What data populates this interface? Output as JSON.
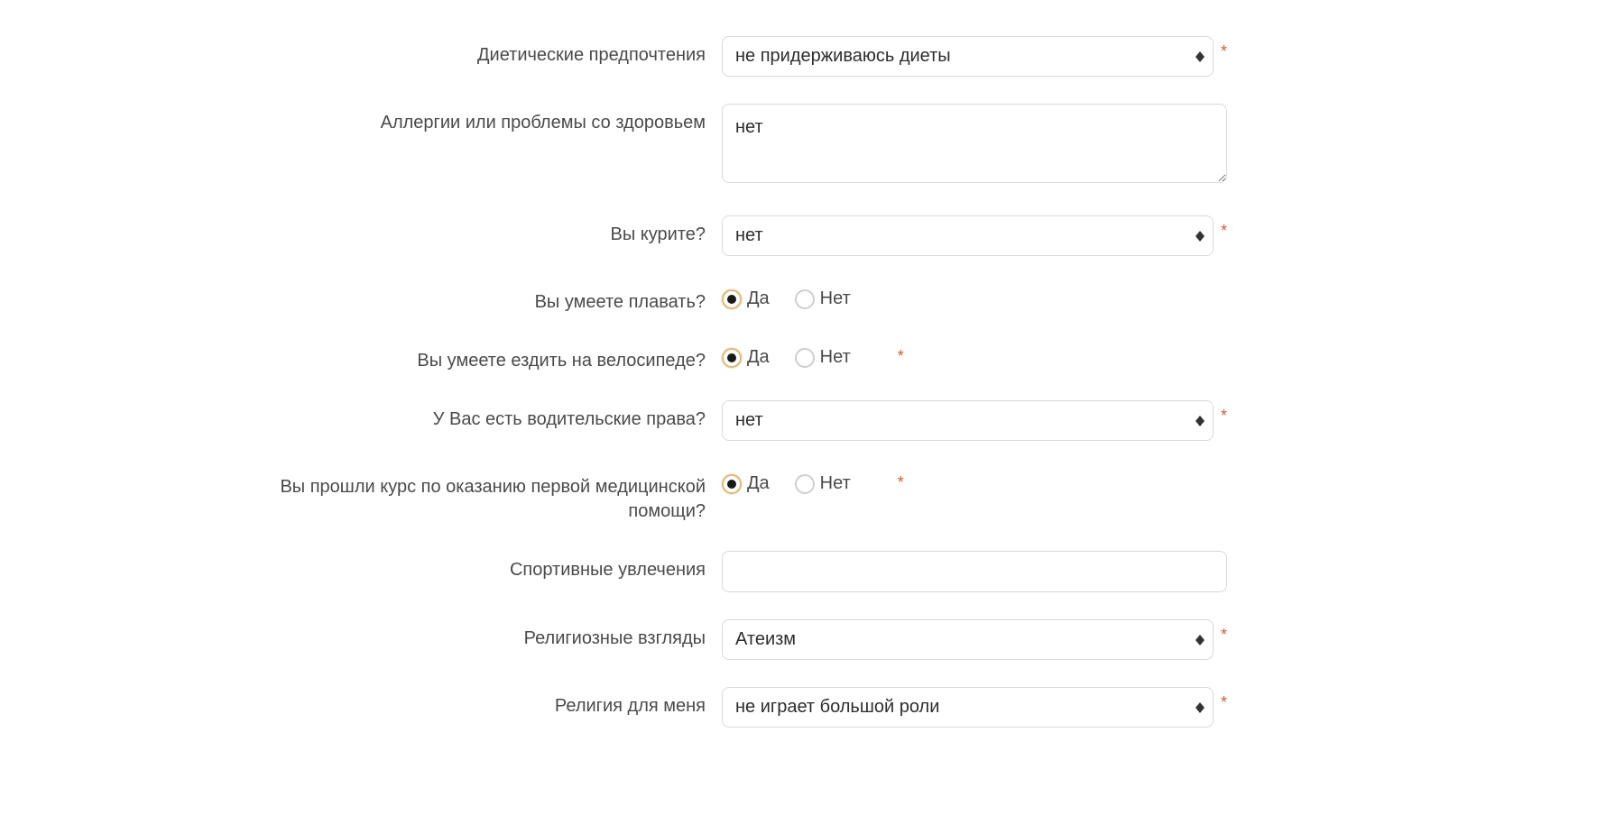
{
  "form": {
    "diet": {
      "label": "Диетические предпочтения",
      "value": "не придерживаюсь диеты",
      "required": true
    },
    "allergies": {
      "label": "Аллергии или проблемы со здоровьем",
      "value": "нет",
      "required": false
    },
    "smoke": {
      "label": "Вы курите?",
      "value": "нет",
      "required": true
    },
    "swim": {
      "label": "Вы умеете плавать?",
      "yes": "Да",
      "no": "Нет",
      "value": "yes",
      "required": false
    },
    "bike": {
      "label": "Вы умеете ездить на велосипеде?",
      "yes": "Да",
      "no": "Нет",
      "value": "yes",
      "required": true
    },
    "driver_license": {
      "label": "У Вас есть водительские права?",
      "value": "нет",
      "required": true
    },
    "first_aid": {
      "label": "Вы прошли курс по оказанию первой медицинской помощи?",
      "yes": "Да",
      "no": "Нет",
      "value": "yes",
      "required": true
    },
    "sports": {
      "label": "Спортивные увлечения",
      "value": "",
      "required": false
    },
    "religion": {
      "label": "Религиозные взгляды",
      "value": "Атеизм",
      "required": true
    },
    "religion_importance": {
      "label": "Религия для меня",
      "value": "не играет большой роли",
      "required": true
    }
  },
  "asterisk": "*"
}
